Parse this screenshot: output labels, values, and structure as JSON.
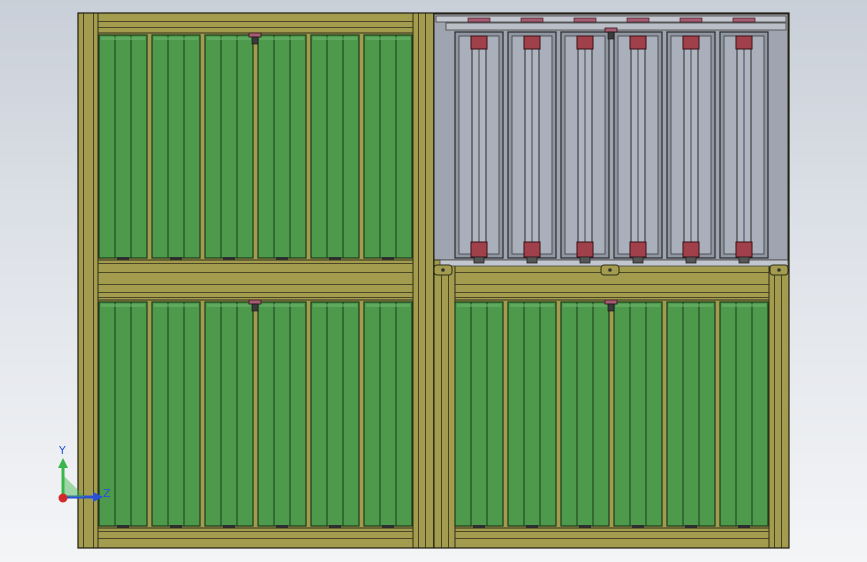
{
  "viewport": {
    "background_top": "#c9cfd8",
    "background_bottom": "#f4f5f7"
  },
  "model": {
    "frame_color": "#a39c4e",
    "frame_edge": "#2f2d1a",
    "panel_color": "#4d9a4c",
    "panel_dark": "#2e6b2f",
    "rack_fill": "#8f97a3",
    "rack_bar_color": "#aeb5c1",
    "cap_color": "#a0404b",
    "connector_color": "#a45d74",
    "quadrants": [
      {
        "name": "top-left",
        "type": "pv-modules",
        "modules": 6,
        "stripes_per_module": 3
      },
      {
        "name": "top-right",
        "type": "rack-frame",
        "bays": 6
      },
      {
        "name": "bottom-left",
        "type": "pv-modules",
        "modules": 6,
        "stripes_per_module": 3
      },
      {
        "name": "bottom-right",
        "type": "pv-modules",
        "modules": 6,
        "stripes_per_module": 3
      }
    ]
  },
  "triad": {
    "y_label": "Y",
    "z_label": "Z",
    "y_color": "#3bb64a",
    "z_color": "#2a4fd8",
    "x_color": "#d22a2a"
  }
}
